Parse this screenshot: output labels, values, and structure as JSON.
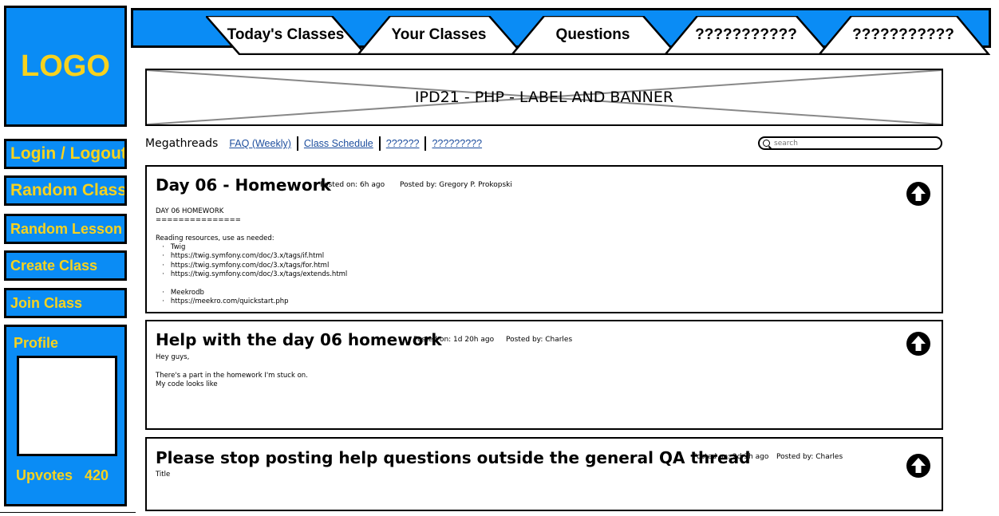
{
  "sidebar": {
    "logo": "LOGO",
    "buttons": [
      "Login / Logout",
      "Random Class",
      "Random Lesson",
      "Create Class",
      "Join Class"
    ],
    "profile": {
      "title": "Profile",
      "upvotes_label": "Upvotes",
      "upvotes_value": "420"
    }
  },
  "tabs": [
    "Today's Classes",
    "Your Classes",
    "Questions",
    "???????????",
    "???????????"
  ],
  "banner": {
    "text": "IPD21 - PHP - LABEL AND BANNER"
  },
  "megathreads": {
    "label": "Megathreads",
    "links": [
      "FAQ (Weekly)",
      "Class Schedule",
      "??????",
      "?????????"
    ]
  },
  "search": {
    "placeholder": "search"
  },
  "posts": [
    {
      "title": "Day 06 - Homework",
      "posted_on": "Posted on: 6h ago",
      "posted_by": "Posted by: Gregory P. Prokopski",
      "body": "DAY 06 HOMEWORK\n===============\n\nReading resources, use as needed:\n   ·   Twig\n   ·   https://twig.symfony.com/doc/3.x/tags/if.html\n   ·   https://twig.symfony.com/doc/3.x/tags/for.html\n   ·   https://twig.symfony.com/doc/3.x/tags/extends.html\n\n   ·   Meekrodb\n   ·   https://meekro.com/quickstart.php"
    },
    {
      "title": "Help with the day 06 homework",
      "posted_on": "Posted on: 1d 20h ago",
      "posted_by": "Posted by: Charles",
      "body": "Hey guys,\n\nThere's a part in the homework I'm stuck on.\nMy code looks like"
    },
    {
      "title": "Please stop posting help questions outside the general QA thread",
      "posted_on": "Posted on: 2d 3h ago",
      "posted_by": "Posted by: Charles",
      "body": "Title"
    }
  ],
  "colors": {
    "panel_blue": "#0a8cf5",
    "label_yellow": "#f7d21e",
    "link_blue": "#1d4e9e"
  },
  "icons": {
    "upvote": "upvote-arrow-circle-icon",
    "search": "search-icon"
  }
}
